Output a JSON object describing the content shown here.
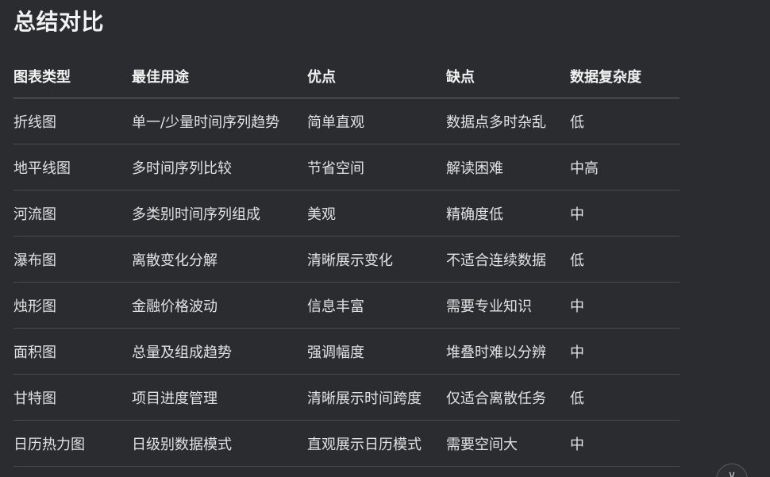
{
  "title": "总结对比",
  "table": {
    "headers": [
      "图表类型",
      "最佳用途",
      "优点",
      "缺点",
      "数据复杂度"
    ],
    "rows": [
      [
        "折线图",
        "单一/少量时间序列趋势",
        "简单直观",
        "数据点多时杂乱",
        "低"
      ],
      [
        "地平线图",
        "多时间序列比较",
        "节省空间",
        "解读困难",
        "中高"
      ],
      [
        "河流图",
        "多类别时间序列组成",
        "美观",
        "精确度低",
        "中"
      ],
      [
        "瀑布图",
        "离散变化分解",
        "清晰展示变化",
        "不适合连续数据",
        "低"
      ],
      [
        "烛形图",
        "金融价格波动",
        "信息丰富",
        "需要专业知识",
        "中"
      ],
      [
        "面积图",
        "总量及组成趋势",
        "强调幅度",
        "堆叠时难以分辨",
        "中"
      ],
      [
        "甘特图",
        "项目进度管理",
        "清晰展示时间跨度",
        "仅适合离散任务",
        "低"
      ],
      [
        "日历热力图",
        "日级别数据模式",
        "直观展示日历模式",
        "需要空间大",
        "中"
      ]
    ]
  },
  "scroll_button": {
    "icon": "chevron-down-icon",
    "glyph": "∨"
  }
}
